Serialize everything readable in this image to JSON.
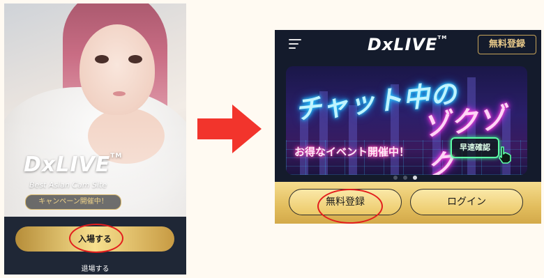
{
  "left_screen": {
    "logo_text": "DxLIVE",
    "logo_tm": "TM",
    "tagline": "Best Asian Cam Site",
    "campaign_badge": "キャンペーン開催中！",
    "enter_button": "入場する",
    "leave_link": "退場する"
  },
  "right_screen": {
    "logo_text": "DxLIVE",
    "logo_tm": "TM",
    "header_register": "無料登録",
    "banner": {
      "title_line1": "チャット中の",
      "title_line2": "ゾクゾク",
      "subtitle": "お得なイベント開催中！",
      "cta": "早速確認"
    },
    "carousel": {
      "count": 3,
      "active_index": 2
    },
    "register_button": "無料登録",
    "login_button": "ログイン"
  },
  "colors": {
    "highlight_ring": "#e31d1d",
    "arrow": "#f2342c",
    "gold": "#e2bd5d",
    "dark_navy": "#141b2c"
  },
  "icons": [
    "menu-icon",
    "arrow-right-icon",
    "pointing-hand-icon"
  ]
}
